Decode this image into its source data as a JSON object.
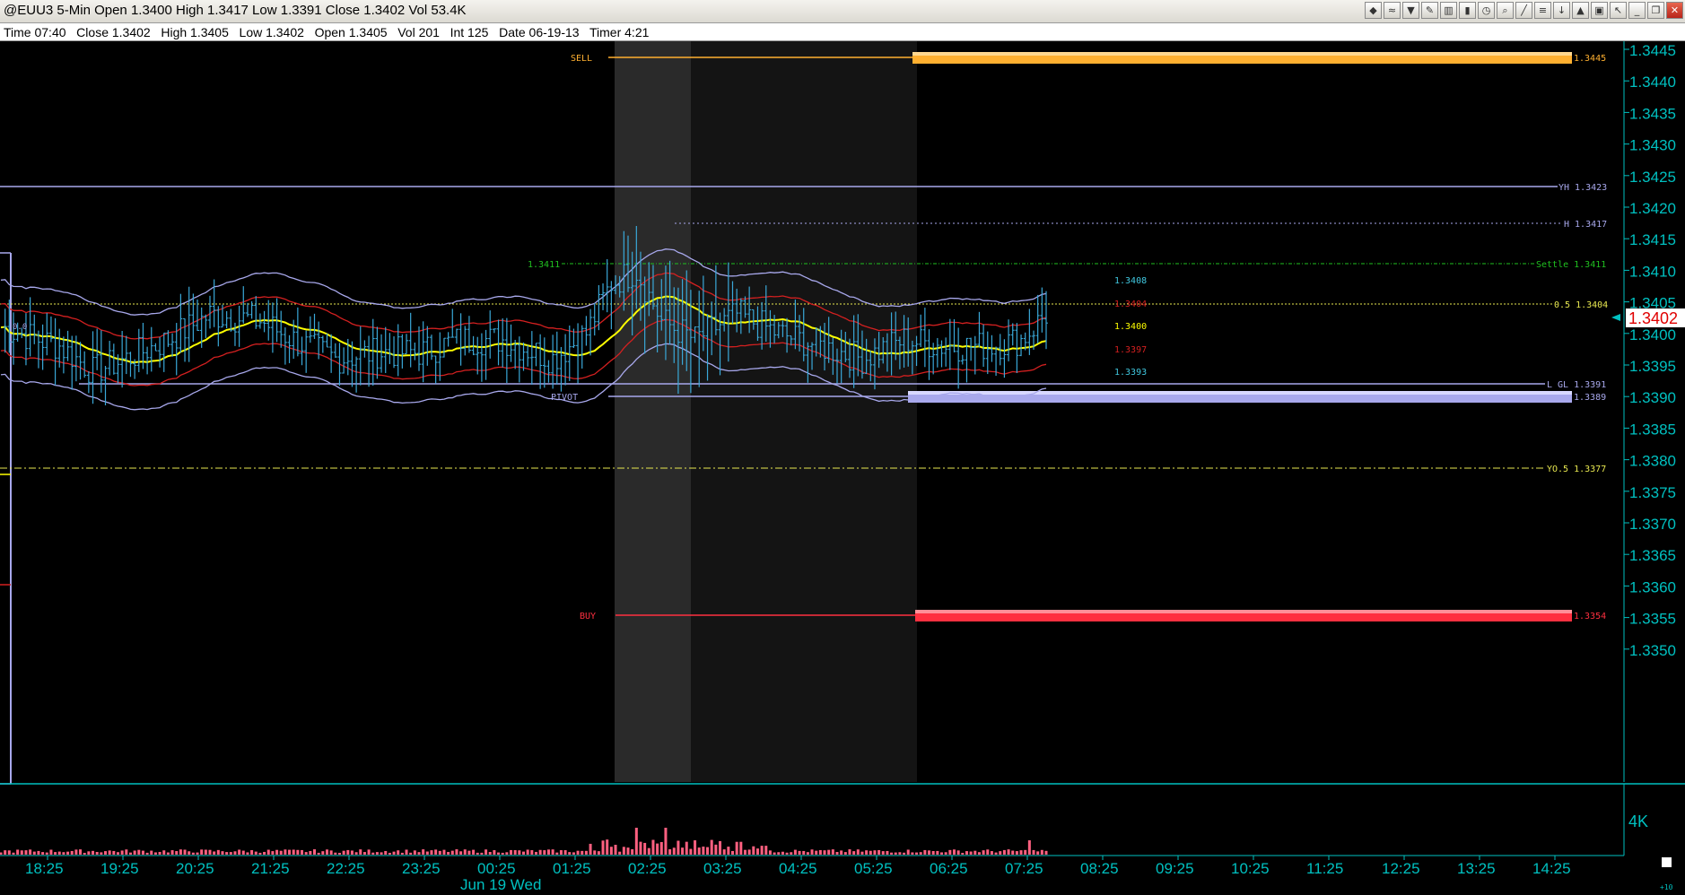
{
  "window": {
    "title": "@EUU3 5-Min Open 1.3400 High 1.3417 Low 1.3391 Close 1.3402 Vol 53.4K",
    "info": "Time 07:40   Close 1.3402   High 1.3405   Low 1.3402   Open 1.3405   Vol 201   Int 125   Date 06-19-13   Timer 4:21"
  },
  "toolbar": [
    {
      "name": "data-icon",
      "glyph": "◆"
    },
    {
      "name": "indicator-icon",
      "glyph": "≈"
    },
    {
      "name": "filter-icon",
      "glyph": "▼"
    },
    {
      "name": "pencil-icon",
      "glyph": "✎"
    },
    {
      "name": "bar-chart-icon",
      "glyph": "▥"
    },
    {
      "name": "candlestick-icon",
      "glyph": "▮"
    },
    {
      "name": "clock-icon",
      "glyph": "◷"
    },
    {
      "name": "zoom-icon",
      "glyph": "⌕"
    },
    {
      "name": "trendline-icon",
      "glyph": "╱"
    },
    {
      "name": "fib-icon",
      "glyph": "≡"
    },
    {
      "name": "down-arrow-icon",
      "glyph": "↓"
    },
    {
      "name": "marker-icon",
      "glyph": "▲"
    },
    {
      "name": "trash-icon",
      "glyph": "▣"
    },
    {
      "name": "cursor-icon",
      "glyph": "↖"
    },
    {
      "name": "minimize-icon",
      "glyph": "_"
    },
    {
      "name": "restore-icon",
      "glyph": "❐"
    },
    {
      "name": "close-icon",
      "glyph": "✕"
    }
  ],
  "colors": {
    "background": "#000000",
    "bars": "#3aa8d8",
    "yellow": "#ffff00",
    "red": "#d42020",
    "lavender": "#a8a8ec",
    "axis": "#00c0c0",
    "sell": "#ffb030",
    "buy": "#ff3040",
    "volume": "#ff6080"
  },
  "price_axis": {
    "ticks": [
      "1.3445",
      "1.3440",
      "1.3435",
      "1.3430",
      "1.3425",
      "1.3420",
      "1.3415",
      "1.3410",
      "1.3405",
      "1.3400",
      "1.3395",
      "1.3390",
      "1.3385",
      "1.3380",
      "1.3375",
      "1.3370",
      "1.3365",
      "1.3360",
      "1.3355",
      "1.3350"
    ],
    "current": "1.3402"
  },
  "time_axis": {
    "ticks": [
      "18:25",
      "19:25",
      "20:25",
      "21:25",
      "22:25",
      "23:25",
      "00:25",
      "01:25",
      "02:25",
      "03:25",
      "04:25",
      "05:25",
      "06:25",
      "07:25",
      "08:25",
      "09:25",
      "10:25",
      "11:25",
      "12:25",
      "13:25",
      "14:25"
    ],
    "date": "Jun 19 Wed"
  },
  "levels": {
    "sell": {
      "label": "SELL",
      "value": "1.3445"
    },
    "yh": {
      "label": "YH 1.3423"
    },
    "h": {
      "label": "H 1.3417"
    },
    "settle": {
      "left": "1.3411",
      "right": "Settle 1.3411"
    },
    "half": {
      "label": "0.5 1.3404"
    },
    "lgl": {
      "label": "L GL 1.3391"
    },
    "pivot": {
      "label": "PIVOT",
      "value": "1.3389"
    },
    "y05": {
      "label": "YO.5 1.3377"
    },
    "buy": {
      "label": "BUY",
      "value": "1.3354"
    }
  },
  "band_labels": {
    "upper": "1.3408",
    "mid_upper": "1.3404",
    "center": "1.3400",
    "mid_lower": "1.3397",
    "lower": "1.3393"
  },
  "left_tag": "0.0",
  "volume_label": "4K",
  "corner_label": "+10",
  "chart_data": {
    "type": "line",
    "symbol": "@EUU3",
    "interval": "5-Min",
    "ylim": [
      1.3347,
      1.3449
    ],
    "approx_path": [
      [
        0,
        1.3401
      ],
      [
        14,
        1.3398
      ],
      [
        22,
        1.3394
      ],
      [
        30,
        1.3396
      ],
      [
        40,
        1.3399
      ],
      [
        50,
        1.3403
      ],
      [
        62,
        1.3402
      ],
      [
        70,
        1.3399
      ],
      [
        80,
        1.3396
      ],
      [
        90,
        1.3397
      ],
      [
        100,
        1.3397
      ],
      [
        110,
        1.3399
      ],
      [
        120,
        1.3399
      ],
      [
        132,
        1.3396
      ],
      [
        140,
        1.34
      ],
      [
        146,
        1.3408
      ],
      [
        152,
        1.341
      ],
      [
        158,
        1.3402
      ],
      [
        166,
        1.3399
      ],
      [
        176,
        1.3403
      ],
      [
        186,
        1.34
      ],
      [
        196,
        1.3398
      ],
      [
        206,
        1.3396
      ],
      [
        216,
        1.3399
      ],
      [
        226,
        1.3398
      ],
      [
        236,
        1.3398
      ],
      [
        244,
        1.3399
      ],
      [
        250,
        1.3403
      ]
    ]
  }
}
